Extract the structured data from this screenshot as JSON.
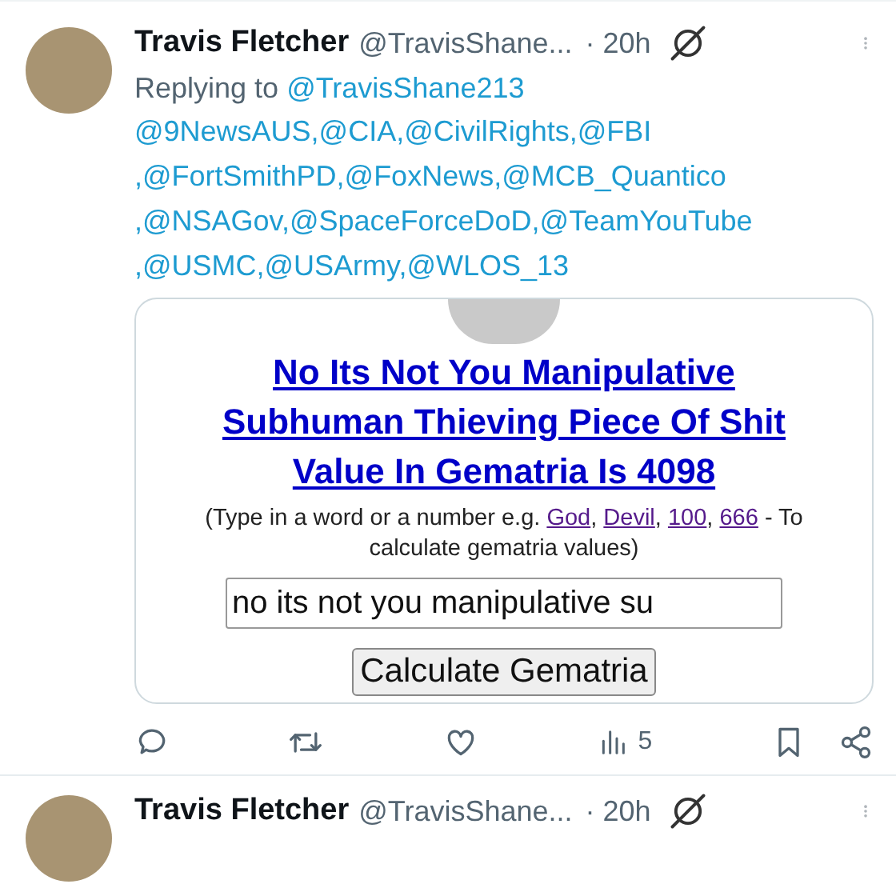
{
  "tweets": [
    {
      "author": "Travis Fletcher",
      "handle": "@TravisShane...",
      "time": "· 20h",
      "replying_label": "Replying to",
      "replying_handle": "@TravisShane213",
      "mention_lines": [
        "@9NewsAUS,@CIA,@CivilRights,@FBI",
        ",@FortSmithPD,@FoxNews,@MCB_Quantico",
        ",@NSAGov,@SpaceForceDoD,@TeamYouTube",
        ",@USMC,@USArmy,@WLOS_13"
      ],
      "card": {
        "title_lines": [
          "No Its Not You Manipulative",
          "Subhuman Thieving Piece Of Shit",
          "Value In Gematria Is 4098"
        ],
        "caption_prefix": "(Type in a word or a number e.g. ",
        "caption_links": [
          "God",
          "Devil",
          "100",
          "666"
        ],
        "caption_separator": ", ",
        "caption_suffix": " - To calculate gematria values)",
        "input_value": "no its not you manipulative su",
        "button": "Calculate Gematria"
      },
      "views": "5"
    },
    {
      "author": "Travis Fletcher",
      "handle": "@TravisShane...",
      "time": "· 20h"
    }
  ]
}
